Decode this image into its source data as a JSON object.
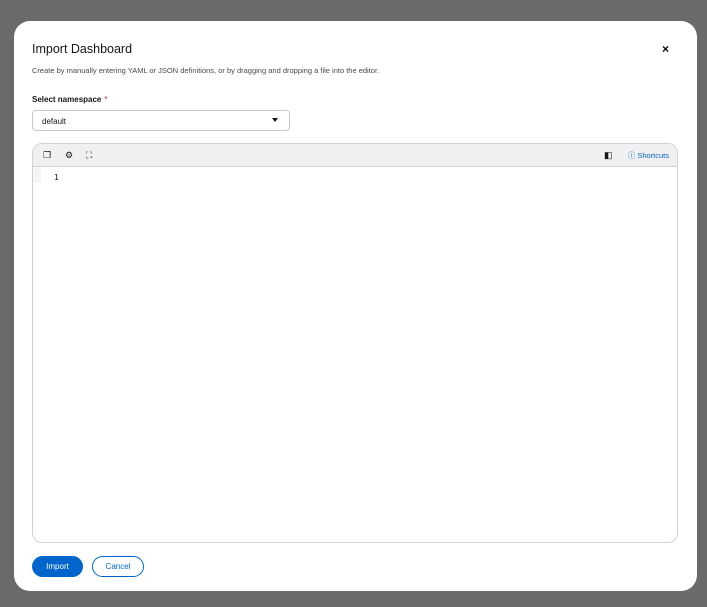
{
  "modal": {
    "title": "Import Dashboard",
    "close": "×",
    "description": "Create by manually entering YAML or JSON definitions, or by dragging and dropping a file into the editor."
  },
  "namespace": {
    "label": "Select namespace",
    "required": "*",
    "value": "default"
  },
  "editor": {
    "shortcuts": "Shortcuts",
    "line_numbers": [
      "1"
    ]
  },
  "footer": {
    "import": "Import",
    "cancel": "Cancel"
  }
}
